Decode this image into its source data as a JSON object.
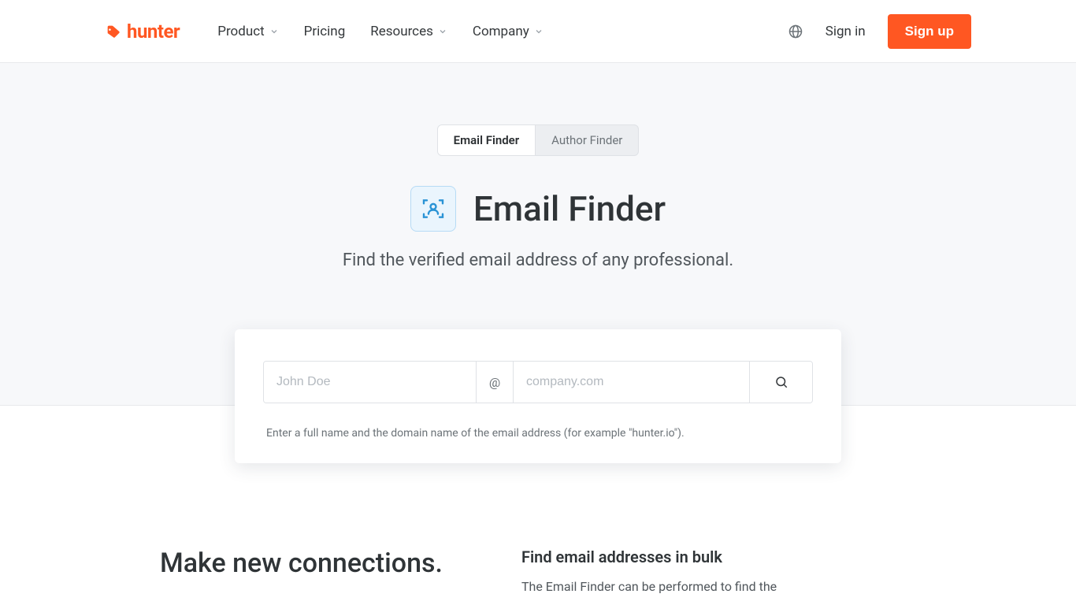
{
  "brand": {
    "name": "hunter"
  },
  "nav": {
    "items": [
      {
        "label": "Product",
        "has_chevron": true
      },
      {
        "label": "Pricing",
        "has_chevron": false
      },
      {
        "label": "Resources",
        "has_chevron": true
      },
      {
        "label": "Company",
        "has_chevron": true
      }
    ],
    "signin": "Sign in",
    "signup": "Sign up"
  },
  "tabs": {
    "active": "Email Finder",
    "inactive": "Author Finder"
  },
  "hero": {
    "title": "Email Finder",
    "subtitle": "Find the verified email address of any professional."
  },
  "search": {
    "name_placeholder": "John Doe",
    "at_symbol": "@",
    "domain_placeholder": "company.com",
    "hint": "Enter a full name and the domain name of the email address (for example \"hunter.io\")."
  },
  "section2": {
    "left_heading": "Make new connections.",
    "right_heading": "Find email addresses in bulk",
    "right_body": "The Email Finder can be performed to find the"
  },
  "colors": {
    "accent": "#ff5722"
  }
}
